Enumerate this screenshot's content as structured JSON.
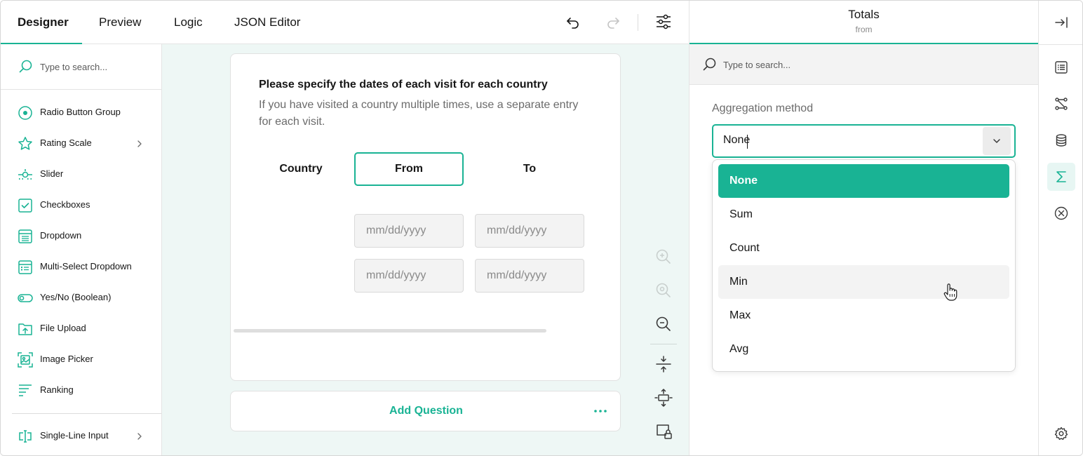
{
  "colors": {
    "accent": "#19b394",
    "canvas_bg": "#eef7f5",
    "text": "#161616",
    "muted": "#6b6b6b"
  },
  "topbar": {
    "tabs": [
      "Designer",
      "Preview",
      "Logic",
      "JSON Editor"
    ],
    "active_tab": "Designer",
    "icons": [
      "undo-icon",
      "redo-icon",
      "settings-sliders-icon"
    ]
  },
  "toolbox": {
    "search_placeholder": "Type to search...",
    "items": [
      {
        "label": "Radio Button Group",
        "icon": "radio-group-icon",
        "has_submenu": false
      },
      {
        "label": "Rating Scale",
        "icon": "star-icon",
        "has_submenu": true
      },
      {
        "label": "Slider",
        "icon": "slider-icon",
        "has_submenu": false
      },
      {
        "label": "Checkboxes",
        "icon": "checkbox-icon",
        "has_submenu": false
      },
      {
        "label": "Dropdown",
        "icon": "dropdown-icon",
        "has_submenu": false
      },
      {
        "label": "Multi-Select Dropdown",
        "icon": "multi-dropdown-icon",
        "has_submenu": false
      },
      {
        "label": "Yes/No (Boolean)",
        "icon": "toggle-icon",
        "has_submenu": false
      },
      {
        "label": "File Upload",
        "icon": "file-upload-icon",
        "has_submenu": false
      },
      {
        "label": "Image Picker",
        "icon": "image-picker-icon",
        "has_submenu": false
      },
      {
        "label": "Ranking",
        "icon": "ranking-icon",
        "has_submenu": false
      },
      {
        "label": "Single-Line Input",
        "icon": "text-input-icon",
        "has_submenu": true
      }
    ]
  },
  "question": {
    "title": "Please specify the dates of each visit for each country",
    "description": "If you have visited a country multiple times, use a separate entry for each visit.",
    "columns": [
      "Country",
      "From",
      "To"
    ],
    "selected_column": "From",
    "date_placeholder": "mm/dd/yyyy",
    "add_question_label": "Add Question"
  },
  "canvas_tools": [
    "zoom-in-icon",
    "zoom-reset-icon",
    "zoom-out-icon",
    "collapse-icon",
    "expand-icon",
    "lock-icon"
  ],
  "properties": {
    "title": "Totals",
    "subtitle": "from",
    "search_placeholder": "Type to search...",
    "field_label": "Aggregation method",
    "field_value": "None",
    "options": [
      "None",
      "Sum",
      "Count",
      "Min",
      "Max",
      "Avg"
    ],
    "selected_option": "None",
    "hovered_option": "Min"
  },
  "sidebar": {
    "icons": [
      "collapse-panel-icon",
      "general-icon",
      "logic-icon",
      "data-icon",
      "totals-sigma-icon",
      "validation-icon",
      "settings-gear-icon"
    ],
    "active": "totals-sigma-icon"
  }
}
